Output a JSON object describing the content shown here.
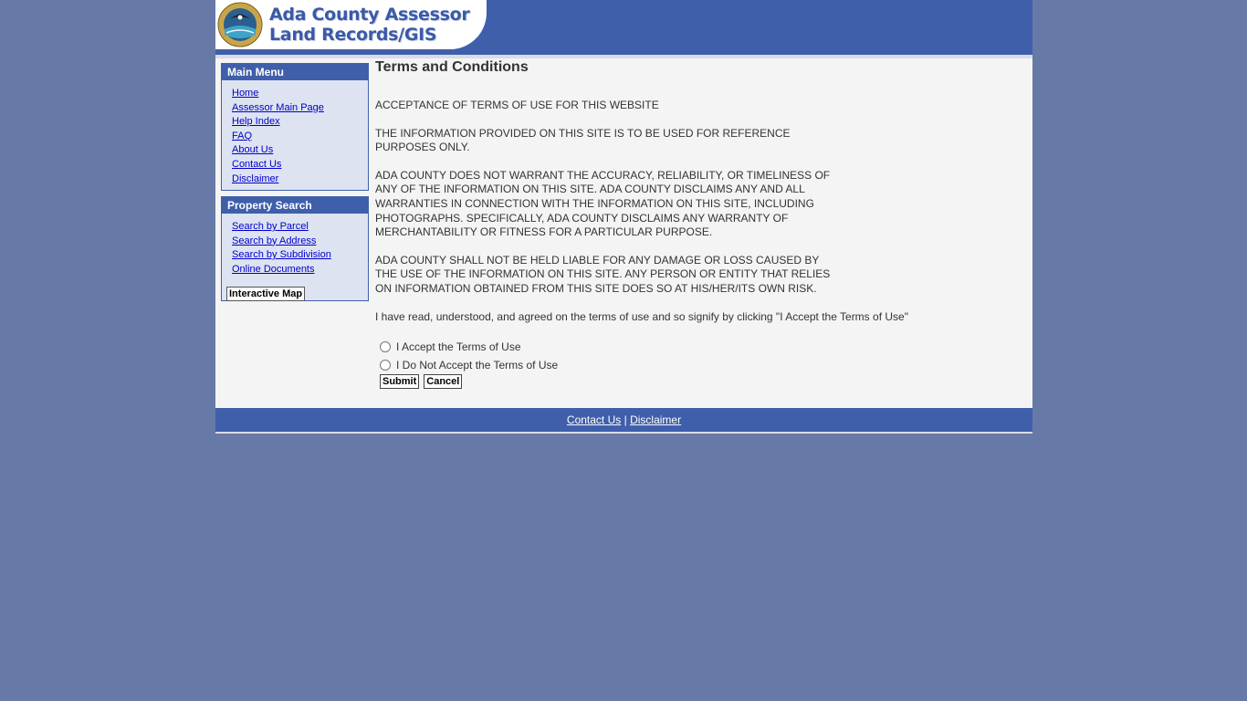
{
  "header": {
    "logo_line1": "Ada County Assessor",
    "logo_line2": "Land Records/GIS",
    "seal_icon": "ada-county-seal-icon"
  },
  "main_menu": {
    "title": "Main Menu",
    "items": [
      "Home",
      "Assessor Main Page",
      "Help Index",
      "FAQ",
      "About Us",
      "Contact Us",
      "Disclaimer"
    ]
  },
  "property_search": {
    "title": "Property Search",
    "items": [
      "Search by Parcel",
      "Search by Address",
      "Search by Subdivision",
      "Online Documents"
    ],
    "map_button": "Interactive Map"
  },
  "terms": {
    "title": "Terms and Conditions",
    "para1": "ACCEPTANCE OF TERMS OF USE FOR THIS WEBSITE",
    "para2": "THE INFORMATION PROVIDED ON THIS SITE IS TO BE USED FOR REFERENCE PURPOSES ONLY.",
    "para3": "ADA COUNTY DOES NOT WARRANT THE ACCURACY, RELIABILITY, OR TIMELINESS OF ANY OF THE INFORMATION ON THIS SITE. ADA COUNTY DISCLAIMS ANY AND ALL WARRANTIES IN CONNECTION WITH THE INFORMATION ON THIS SITE, INCLUDING PHOTOGRAPHS. SPECIFICALLY, ADA COUNTY DISCLAIMS ANY WARRANTY OF MERCHANTABILITY OR FITNESS FOR A PARTICULAR PURPOSE.",
    "para4": "ADA COUNTY SHALL NOT BE HELD LIABLE FOR ANY DAMAGE OR LOSS CAUSED BY THE USE OF THE INFORMATION ON THIS SITE. ANY PERSON OR ENTITY THAT RELIES ON INFORMATION OBTAINED FROM THIS SITE DOES SO AT HIS/HER/ITS OWN RISK.",
    "agree_text": "I have read, understood, and agreed on the terms of use and so signify by clicking \"I Accept the Terms of Use\"",
    "accept_label": "I Accept the Terms of Use",
    "decline_label": "I Do Not Accept the Terms of Use",
    "submit_label": "Submit",
    "cancel_label": "Cancel"
  },
  "footer": {
    "contact": "Contact Us",
    "separator": "|",
    "disclaimer": "Disclaimer"
  },
  "colors": {
    "page_bg": "#6779a7",
    "brand_blue": "#3f5fab",
    "content_bg": "#f4f4f4",
    "menu_bg": "#dde3f1",
    "link": "#0000cc"
  }
}
